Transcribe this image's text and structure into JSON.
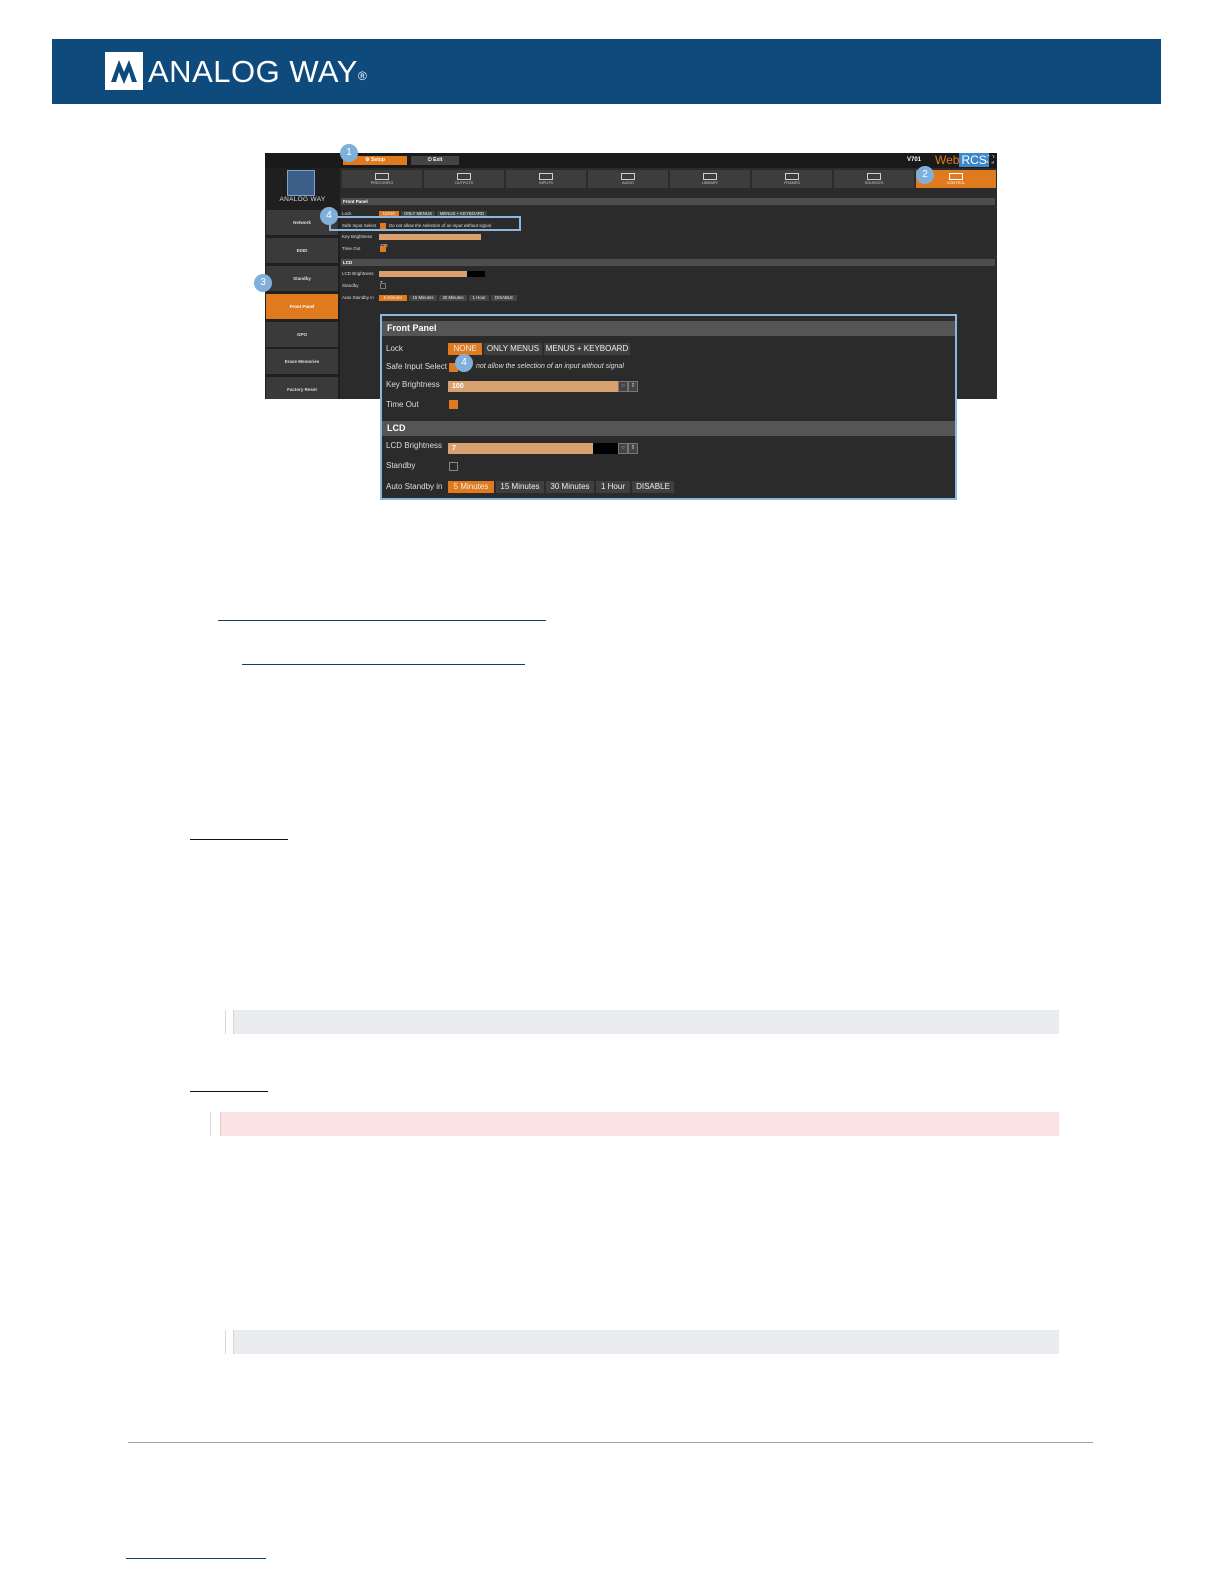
{
  "header": {
    "logo_text": "ANALOG WAY",
    "logo_mark": "®"
  },
  "app": {
    "top_buttons": {
      "setup": "Setup",
      "exit": "Exit"
    },
    "version": "V701",
    "brand": {
      "web": "Web",
      "rcs": "RCS"
    },
    "sidebar": {
      "logo_text": "ANALOG WAY",
      "items": [
        "Network",
        "EDID",
        "Standby",
        "Front Panel",
        "GPO",
        "Erase Memories",
        "Factory Reset"
      ]
    },
    "tabs": [
      "PRECONFIG",
      "OUTPUTS",
      "INPUTS",
      "AUDIO",
      "LIBRARY",
      "FRAMES",
      "SOURCES",
      "CONTROL"
    ],
    "front_panel": {
      "section": "Front Panel",
      "lock_label": "Lock",
      "lock_options": [
        "NONE",
        "ONLY MENUS",
        "MENUS + KEYBOARD"
      ],
      "safe_input_label": "Safe Input Select",
      "safe_input_hint": "Do not allow the selection of an input without signal",
      "zoom_safe_input_hint": "not allow the selection of an input without signal",
      "key_brightness_label": "Key Brightness",
      "key_brightness_value": "100",
      "timeout_label": "Time Out"
    },
    "lcd": {
      "section": "LCD",
      "brightness_label": "LCD Brightness",
      "brightness_value": "7",
      "standby_label": "Standby",
      "auto_standby_label": "Auto Standby in",
      "auto_standby_options": [
        "5 Minutes",
        "15 Minutes",
        "30 Minutes",
        "1 Hour",
        "DISABLE"
      ]
    }
  },
  "callouts": [
    "1",
    "2",
    "3",
    "4",
    "4"
  ],
  "colors": {
    "banner": "#0e4a7c",
    "accent": "#e07a1f",
    "callout": "#7fb0dc"
  }
}
